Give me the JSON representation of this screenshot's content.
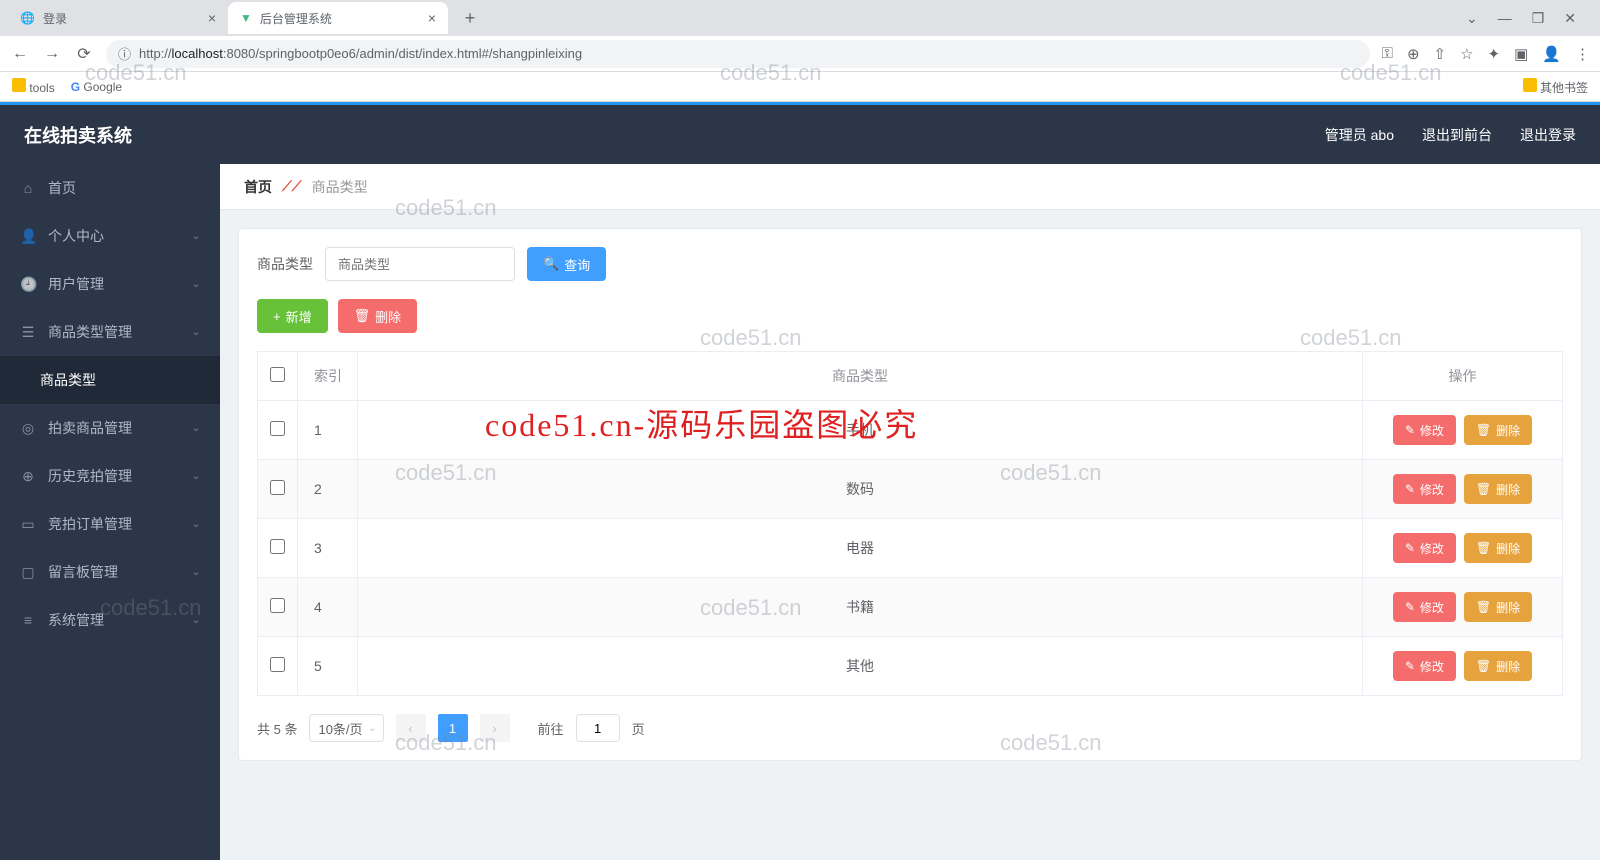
{
  "browser": {
    "tabs": [
      {
        "title": "登录",
        "icon": "globe"
      },
      {
        "title": "后台管理系统",
        "icon": "vue"
      }
    ],
    "url_prefix": "http://",
    "url_host": "localhost",
    "url_rest": ":8080/springbootp0eo6/admin/dist/index.html#/shangpinleixing",
    "bookmarks": {
      "tools": "tools",
      "google": "Google",
      "other": "其他书签"
    }
  },
  "topbar": {
    "logo": "在线拍卖系统",
    "admin": "管理员 abo",
    "front": "退出到前台",
    "logout": "退出登录"
  },
  "sidebar": {
    "items": [
      {
        "icon": "⌂",
        "label": "首页",
        "expandable": false
      },
      {
        "icon": "👤",
        "label": "个人中心",
        "expandable": true
      },
      {
        "icon": "🕘",
        "label": "用户管理",
        "expandable": true
      },
      {
        "icon": "☰",
        "label": "商品类型管理",
        "expandable": true
      },
      {
        "icon": "",
        "label": "商品类型",
        "expandable": false,
        "sub": true
      },
      {
        "icon": "◎",
        "label": "拍卖商品管理",
        "expandable": true
      },
      {
        "icon": "⊕",
        "label": "历史竞拍管理",
        "expandable": true
      },
      {
        "icon": "▭",
        "label": "竞拍订单管理",
        "expandable": true
      },
      {
        "icon": "▢",
        "label": "留言板管理",
        "expandable": true
      },
      {
        "icon": "≡",
        "label": "系统管理",
        "expandable": true
      }
    ]
  },
  "breadcrumb": {
    "home": "首页",
    "current": "商品类型"
  },
  "search": {
    "label": "商品类型",
    "placeholder": "商品类型",
    "query_btn": "查询"
  },
  "actions": {
    "add": "新增",
    "delete": "删除"
  },
  "table": {
    "headers": {
      "index": "索引",
      "type": "商品类型",
      "ops": "操作"
    },
    "rows": [
      {
        "idx": "1",
        "type": "手机"
      },
      {
        "idx": "2",
        "type": "数码"
      },
      {
        "idx": "3",
        "type": "电器"
      },
      {
        "idx": "4",
        "type": "书籍"
      },
      {
        "idx": "5",
        "type": "其他"
      }
    ],
    "edit": "修改",
    "del": "删除"
  },
  "pager": {
    "total": "共 5 条",
    "per_page": "10条/页",
    "page": "1",
    "goto_pre": "前往",
    "goto_val": "1",
    "goto_post": "页"
  },
  "watermark": "code51.cn",
  "overlay": "code51.cn-源码乐园盗图必究"
}
